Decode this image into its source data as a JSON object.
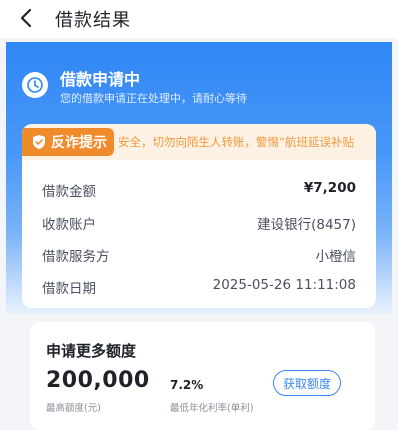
{
  "header": {
    "title": "借款结果",
    "back_icon": "chevron-left-icon"
  },
  "status": {
    "title": "借款申请中",
    "subtitle": "您的借款申请正在处理中，请耐心等待",
    "icon": "clock-icon"
  },
  "anti_fraud": {
    "badge_label": "反诈提示",
    "message": "安全，切勿向陌生人转账，警惕“航班延误补贴"
  },
  "details": [
    {
      "label": "借款金额",
      "value": "¥7,200"
    },
    {
      "label": "收款账户",
      "value": "建设银行(8457)"
    },
    {
      "label": "借款服务方",
      "value": "小橙信"
    },
    {
      "label": "借款日期",
      "value": "2025-05-26 11:11:08"
    }
  ],
  "more_credit": {
    "title": "申请更多额度",
    "amount": "200,000",
    "amount_caption": "最高额度(元)",
    "rate": "7.2%",
    "rate_caption": "最低年化利率(单利)",
    "button_label": "获取额度"
  },
  "colors": {
    "brand_blue": "#2f86f4",
    "warning_orange": "#f08b2b",
    "warning_bg": "#fdf1e3"
  }
}
